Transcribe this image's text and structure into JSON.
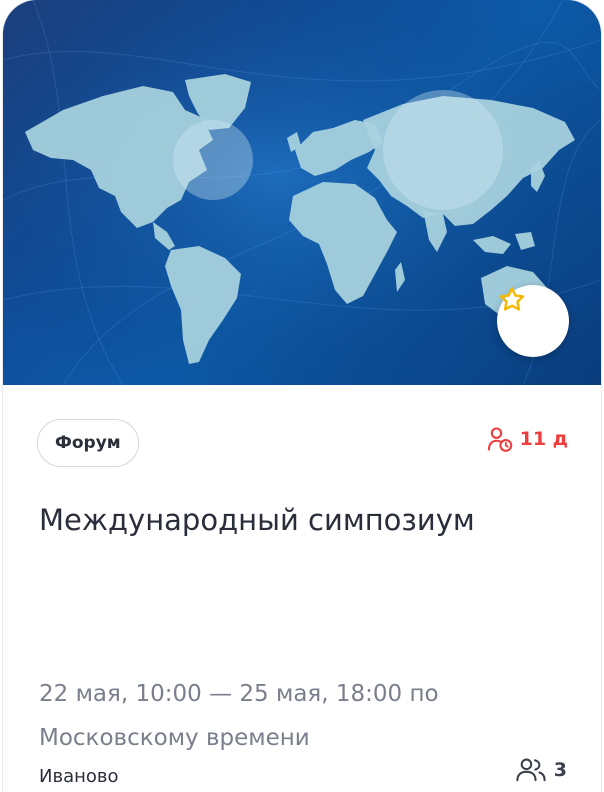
{
  "event": {
    "category": "Форум",
    "deadline": "11 д",
    "title": "Международный симпозиум",
    "dates": "22 мая, 10:00 — 25 мая, 18:00 по Московскому времени",
    "city": "Иваново",
    "participants": "3"
  },
  "icons": {
    "favorite": "star-icon",
    "deadline": "user-clock-icon",
    "participants": "users-icon"
  },
  "colors": {
    "accent_red": "#ee3d3d",
    "star": "#f5b800",
    "hero_blue": "#0f4f9c"
  }
}
